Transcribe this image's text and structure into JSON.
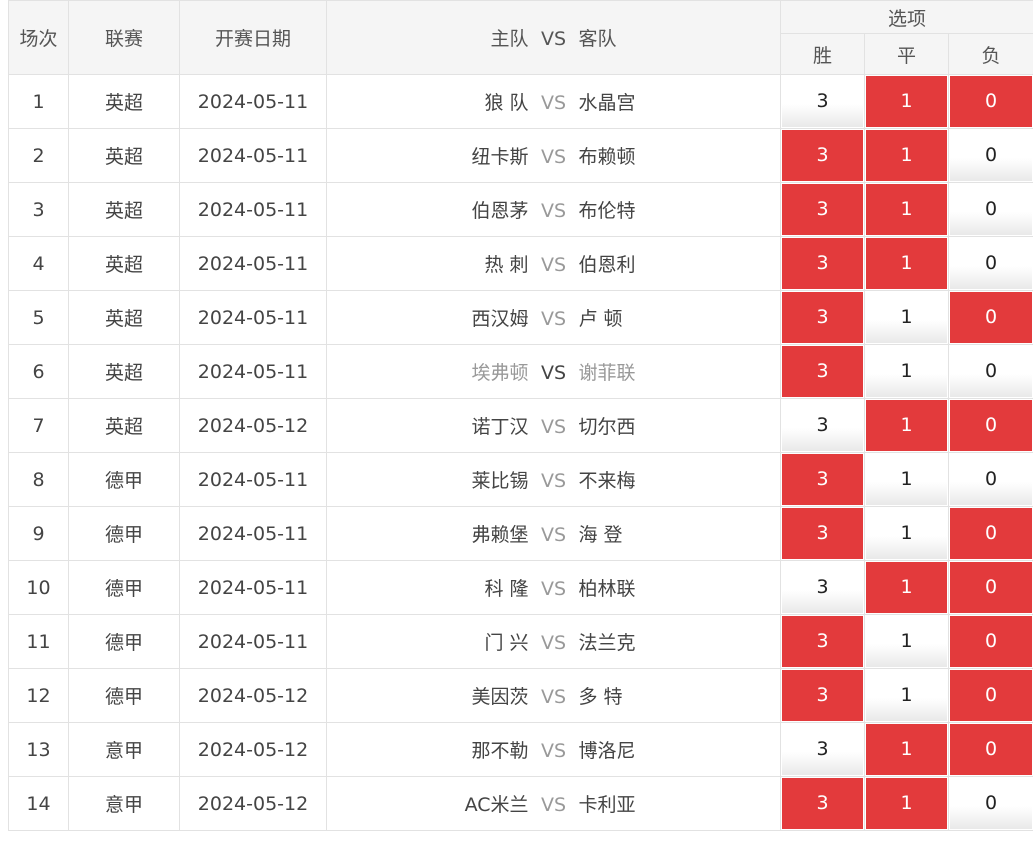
{
  "headers": {
    "round": "场次",
    "league": "联赛",
    "date": "开赛日期",
    "home": "主队",
    "vs": "VS",
    "away": "客队",
    "options": "选项",
    "win": "胜",
    "draw": "平",
    "loss": "负"
  },
  "colors": {
    "selected": "#e33a3c",
    "unselected": "#ffffff"
  },
  "matches": [
    {
      "no": "1",
      "league": "英超",
      "date": "2024-05-11",
      "home": "狼 队",
      "vs": "VS",
      "away": "水晶宫",
      "win": "3",
      "draw": "1",
      "loss": "0",
      "win_sel": false,
      "draw_sel": true,
      "loss_sel": true
    },
    {
      "no": "2",
      "league": "英超",
      "date": "2024-05-11",
      "home": "纽卡斯",
      "vs": "VS",
      "away": "布赖顿",
      "win": "3",
      "draw": "1",
      "loss": "0",
      "win_sel": true,
      "draw_sel": true,
      "loss_sel": false
    },
    {
      "no": "3",
      "league": "英超",
      "date": "2024-05-11",
      "home": "伯恩茅",
      "vs": "VS",
      "away": "布伦特",
      "win": "3",
      "draw": "1",
      "loss": "0",
      "win_sel": true,
      "draw_sel": true,
      "loss_sel": false
    },
    {
      "no": "4",
      "league": "英超",
      "date": "2024-05-11",
      "home": "热 刺",
      "vs": "VS",
      "away": "伯恩利",
      "win": "3",
      "draw": "1",
      "loss": "0",
      "win_sel": true,
      "draw_sel": true,
      "loss_sel": false
    },
    {
      "no": "5",
      "league": "英超",
      "date": "2024-05-11",
      "home": "西汉姆",
      "vs": "VS",
      "away": "卢 顿",
      "win": "3",
      "draw": "1",
      "loss": "0",
      "win_sel": true,
      "draw_sel": false,
      "loss_sel": true
    },
    {
      "no": "6",
      "league": "英超",
      "date": "2024-05-11",
      "home": "埃弗顿",
      "vs": "VS",
      "away": "谢菲联",
      "win": "3",
      "draw": "1",
      "loss": "0",
      "win_sel": true,
      "draw_sel": false,
      "loss_sel": false,
      "dimmed": true
    },
    {
      "no": "7",
      "league": "英超",
      "date": "2024-05-12",
      "home": "诺丁汉",
      "vs": "VS",
      "away": "切尔西",
      "win": "3",
      "draw": "1",
      "loss": "0",
      "win_sel": false,
      "draw_sel": true,
      "loss_sel": true
    },
    {
      "no": "8",
      "league": "德甲",
      "date": "2024-05-11",
      "home": "莱比锡",
      "vs": "VS",
      "away": "不来梅",
      "win": "3",
      "draw": "1",
      "loss": "0",
      "win_sel": true,
      "draw_sel": false,
      "loss_sel": false
    },
    {
      "no": "9",
      "league": "德甲",
      "date": "2024-05-11",
      "home": "弗赖堡",
      "vs": "VS",
      "away": "海 登",
      "win": "3",
      "draw": "1",
      "loss": "0",
      "win_sel": true,
      "draw_sel": false,
      "loss_sel": true
    },
    {
      "no": "10",
      "league": "德甲",
      "date": "2024-05-11",
      "home": "科 隆",
      "vs": "VS",
      "away": "柏林联",
      "win": "3",
      "draw": "1",
      "loss": "0",
      "win_sel": false,
      "draw_sel": true,
      "loss_sel": true
    },
    {
      "no": "11",
      "league": "德甲",
      "date": "2024-05-11",
      "home": "门 兴",
      "vs": "VS",
      "away": "法兰克",
      "win": "3",
      "draw": "1",
      "loss": "0",
      "win_sel": true,
      "draw_sel": false,
      "loss_sel": true
    },
    {
      "no": "12",
      "league": "德甲",
      "date": "2024-05-12",
      "home": "美因茨",
      "vs": "VS",
      "away": "多 特",
      "win": "3",
      "draw": "1",
      "loss": "0",
      "win_sel": true,
      "draw_sel": false,
      "loss_sel": true
    },
    {
      "no": "13",
      "league": "意甲",
      "date": "2024-05-12",
      "home": "那不勒",
      "vs": "VS",
      "away": "博洛尼",
      "win": "3",
      "draw": "1",
      "loss": "0",
      "win_sel": false,
      "draw_sel": true,
      "loss_sel": true
    },
    {
      "no": "14",
      "league": "意甲",
      "date": "2024-05-12",
      "home": "AC米兰",
      "vs": "VS",
      "away": "卡利亚",
      "win": "3",
      "draw": "1",
      "loss": "0",
      "win_sel": true,
      "draw_sel": true,
      "loss_sel": false
    }
  ]
}
